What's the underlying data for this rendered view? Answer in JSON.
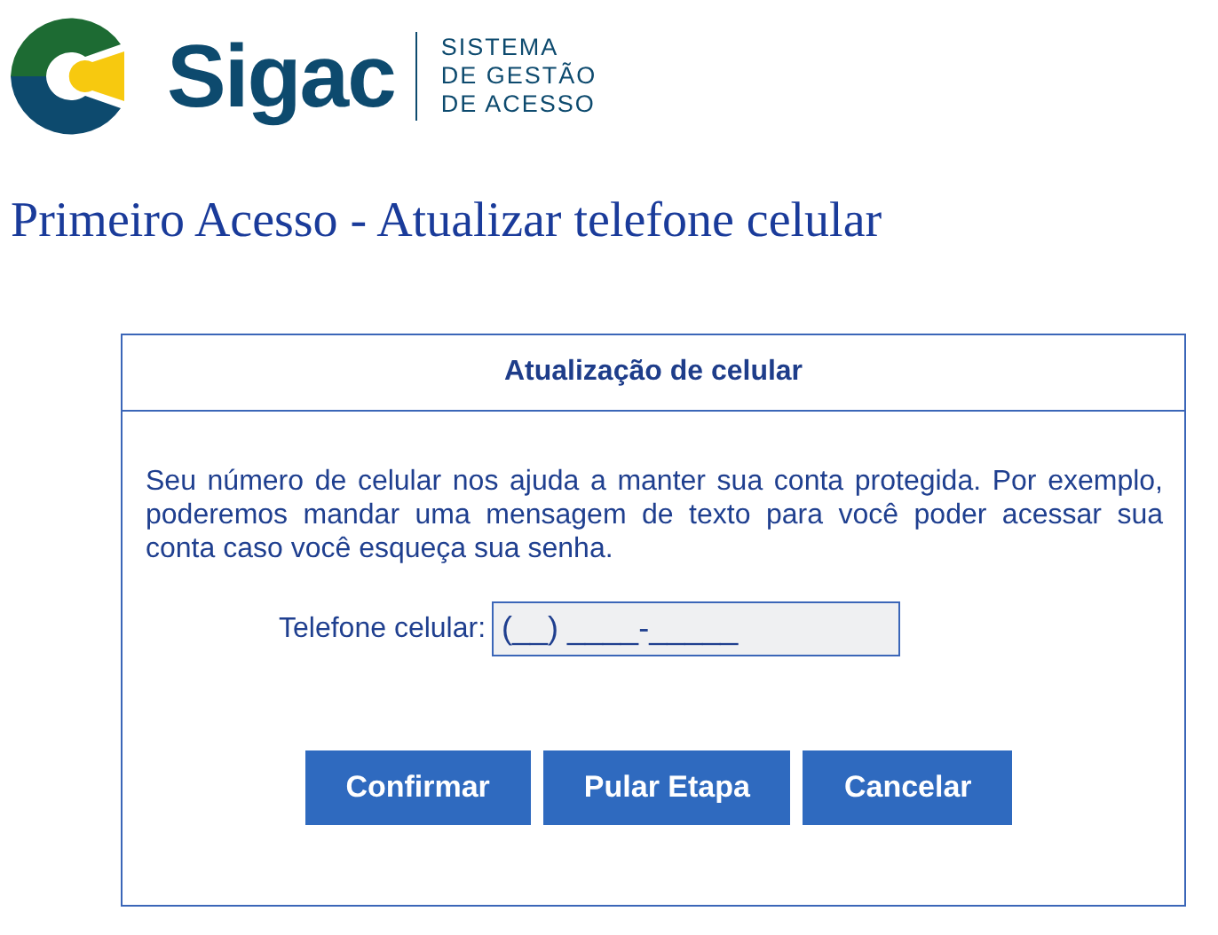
{
  "logo": {
    "wordmark": "Sigac",
    "tagline": [
      "SISTEMA",
      "DE GESTÃO",
      "DE ACESSO"
    ]
  },
  "page_title": "Primeiro Acesso - Atualizar telefone celular",
  "card": {
    "title": "Atualização de celular",
    "description": "Seu número de celular nos ajuda a manter sua conta protegida. Por exemplo, poderemos mandar uma mensagem de texto para você poder acessar sua conta caso você esqueça sua senha.",
    "phone_field": {
      "label": "Telefone celular:",
      "value": "(__) ____-_____"
    },
    "buttons": [
      "Confirmar",
      "Pular Etapa",
      "Cancelar"
    ]
  }
}
